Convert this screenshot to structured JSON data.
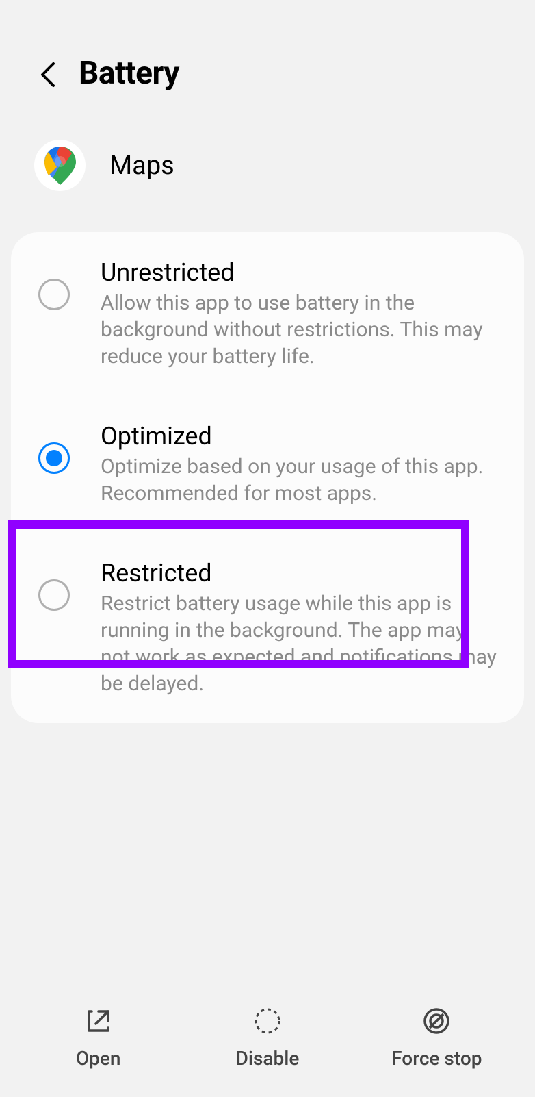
{
  "header": {
    "title": "Battery"
  },
  "app": {
    "name": "Maps"
  },
  "options": [
    {
      "id": "unrestricted",
      "title": "Unrestricted",
      "description": "Allow this app to use battery in the background without restrictions. This may reduce your battery life.",
      "selected": false
    },
    {
      "id": "optimized",
      "title": "Optimized",
      "description": "Optimize based on your usage of this app. Recommended for most apps.",
      "selected": true
    },
    {
      "id": "restricted",
      "title": "Restricted",
      "description": "Restrict battery usage while this app is running in the background. The app may not work as expected and notifications may be delayed.",
      "selected": false,
      "highlighted": true
    }
  ],
  "bottomBar": {
    "open": "Open",
    "disable": "Disable",
    "forceStop": "Force stop"
  }
}
